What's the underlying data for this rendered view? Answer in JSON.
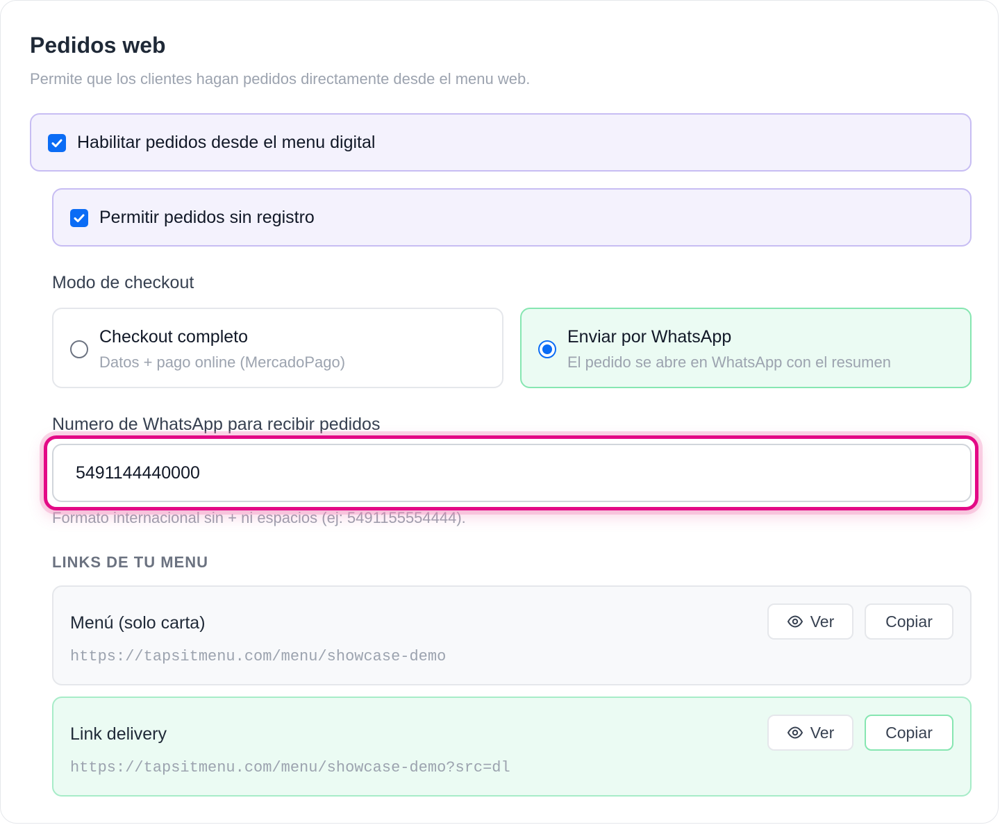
{
  "header": {
    "title": "Pedidos web",
    "subtitle": "Permite que los clientes hagan pedidos directamente desde el menu web."
  },
  "options": {
    "enable_orders": {
      "label": "Habilitar pedidos desde el menu digital",
      "checked": true
    },
    "guest_orders": {
      "label": "Permitir pedidos sin registro",
      "checked": true
    }
  },
  "checkout": {
    "label": "Modo de checkout",
    "modes": [
      {
        "title": "Checkout completo",
        "description": "Datos + pago online (MercadoPago)",
        "selected": false
      },
      {
        "title": "Enviar por WhatsApp",
        "description": "El pedido se abre en WhatsApp con el resumen",
        "selected": true
      }
    ]
  },
  "whatsapp": {
    "label": "Numero de WhatsApp para recibir pedidos",
    "value": "5491144440000",
    "hint": "Formato internacional sin + ni espacios (ej: 5491155554444)."
  },
  "links": {
    "heading": "LINKS DE TU MENU",
    "items": [
      {
        "title": "Menú (solo carta)",
        "url": "https://tapsitmenu.com/menu/showcase-demo",
        "view_label": "Ver",
        "copy_label": "Copiar"
      },
      {
        "title": "Link delivery",
        "url": "https://tapsitmenu.com/menu/showcase-demo?src=dl",
        "view_label": "Ver",
        "copy_label": "Copiar"
      }
    ]
  },
  "colors": {
    "accent_blue": "#0b6cf5",
    "highlight_pink": "#e30a86",
    "selected_green_bg": "#ebfbf3",
    "checkbox_panel_bg": "#f4f2fd"
  }
}
